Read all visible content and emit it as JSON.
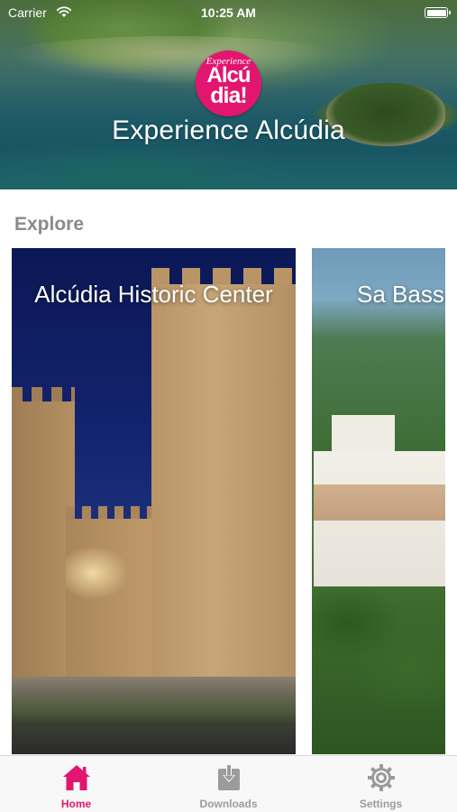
{
  "status_bar": {
    "carrier": "Carrier",
    "time": "10:25 AM"
  },
  "header": {
    "logo_top": "Experience",
    "logo_line1": "Alcú",
    "logo_line2": "dia!",
    "title": "Experience Alcúdia"
  },
  "explore": {
    "title": "Explore",
    "cards": [
      {
        "title": "Alcúdia Historic Center"
      },
      {
        "title": "Sa Bassa Museum"
      }
    ]
  },
  "tab_bar": {
    "tabs": [
      {
        "label": "Home",
        "icon": "house-icon",
        "selected": true
      },
      {
        "label": "Downloads",
        "icon": "download-icon",
        "selected": false
      },
      {
        "label": "Settings",
        "icon": "gear-icon",
        "selected": false
      }
    ]
  },
  "colors": {
    "brand": "#e2166f",
    "section_title": "#8a8a8e",
    "tab_inactive": "#9b9b9b"
  }
}
